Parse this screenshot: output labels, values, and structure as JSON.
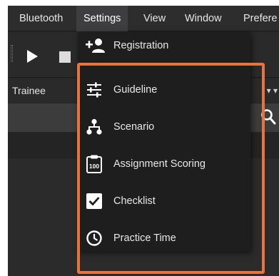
{
  "menubar": {
    "items": [
      {
        "label": "Bluetooth"
      },
      {
        "label": "Settings"
      },
      {
        "label": "View"
      },
      {
        "label": "Window"
      },
      {
        "label": "Prefere"
      }
    ]
  },
  "toolbar": {
    "play_icon": "play-icon",
    "stop_icon": "stop-icon"
  },
  "panel": {
    "title": "Trainee",
    "pin_glyph": "▾ ▾"
  },
  "settings_menu": {
    "items": [
      {
        "label": "Registration",
        "icon": "add-user-icon"
      },
      {
        "label": "Guideline",
        "icon": "sliders-icon"
      },
      {
        "label": "Scenario",
        "icon": "hierarchy-icon"
      },
      {
        "label": "Assignment Scoring",
        "icon": "clipboard-100-icon",
        "icon_text": "100"
      },
      {
        "label": "Checklist",
        "icon": "checkbox-icon"
      },
      {
        "label": "Practice Time",
        "icon": "clock-icon"
      }
    ]
  },
  "colors": {
    "menubar_bg": "#2d2d2d",
    "dropdown_bg": "#1e1e1e",
    "highlight": "#e8733d",
    "text": "#e8e8e8"
  }
}
